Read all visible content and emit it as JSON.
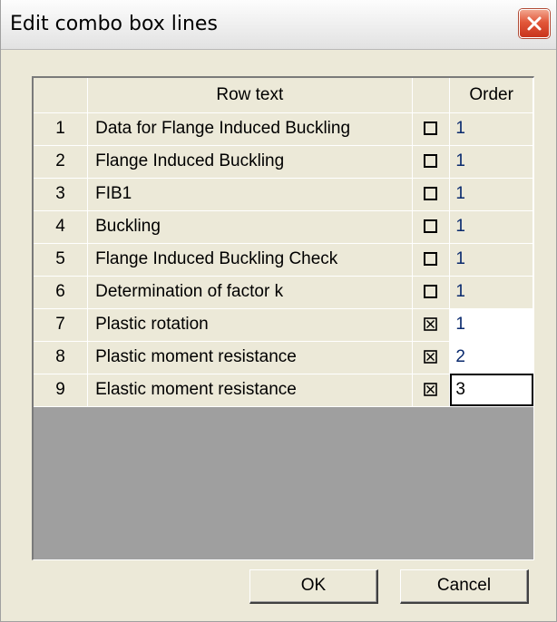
{
  "window": {
    "title": "Edit combo box lines"
  },
  "grid": {
    "headers": {
      "num": "",
      "row_text": "Row text",
      "check": "",
      "order": "Order"
    },
    "rows": [
      {
        "num": "1",
        "text": "Data for Flange Induced Buckling",
        "checked": false,
        "order": "1"
      },
      {
        "num": "2",
        "text": "Flange Induced Buckling",
        "checked": false,
        "order": "1"
      },
      {
        "num": "3",
        "text": "FIB1",
        "checked": false,
        "order": "1"
      },
      {
        "num": "4",
        "text": "Buckling",
        "checked": false,
        "order": "1"
      },
      {
        "num": "5",
        "text": "Flange Induced Buckling Check",
        "checked": false,
        "order": "1"
      },
      {
        "num": "6",
        "text": "Determination of factor k",
        "checked": false,
        "order": "1"
      },
      {
        "num": "7",
        "text": "Plastic rotation",
        "checked": true,
        "order": "1"
      },
      {
        "num": "8",
        "text": "Plastic moment resistance",
        "checked": true,
        "order": "2"
      },
      {
        "num": "9",
        "text": "Elastic moment resistance",
        "checked": true,
        "order": "3"
      }
    ]
  },
  "buttons": {
    "ok": "OK",
    "cancel": "Cancel"
  },
  "colors": {
    "dialog_bg": "#ece9d8",
    "grid_empty_bg": "#9f9f9f",
    "order_text": "#0a2a6e",
    "close_button": "#e2573a"
  },
  "icons": {
    "close": "close-icon",
    "unchecked": "checkbox-unchecked-icon",
    "checked": "checkbox-checked-icon"
  }
}
